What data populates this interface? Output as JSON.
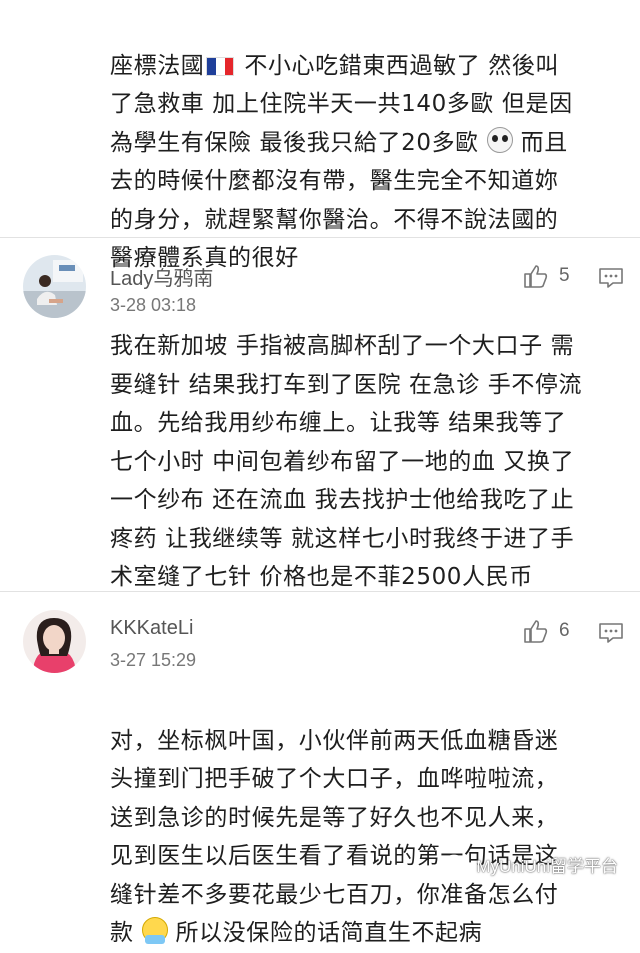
{
  "comments": [
    {
      "text_part1": "座標法國",
      "flag_colors": [
        "#1f3f9a",
        "#ffffff",
        "#e5262b"
      ],
      "text_part2": " 不小心吃錯東西過敏了 然後叫\n了急救車 加上住院半天一共140多歐 但是因\n為學生有保險 最後我只給了20多歐",
      "text_part3": "而且\n去的時候什麼都沒有帶，醫生完全不知道妳\n的身分，就趕緊幫你醫治。不得不說法國的\n醫療體系真的很好"
    },
    {
      "username": "Lady乌鸦南",
      "time": "3-28 03:18",
      "likes": "5",
      "text": "我在新加坡 手指被高脚杯刮了一个大口子 需\n要缝针 结果我打车到了医院 在急诊 手不停流\n血。先给我用纱布缠上。让我等 结果我等了\n七个小时 中间包着纱布留了一地的血 又换了\n一个纱布 还在流血 我去找护士他给我吃了止\n疼药 让我继续等 就这样七小时我终于进了手\n术室缝了七针  价格也是不菲2500人民币"
    },
    {
      "username": "KKKateLi",
      "time": "3-27 15:29",
      "likes": "6",
      "text_part1": "对，坐标枫叶国，小伙伴前两天低血糖昏迷\n头撞到门把手破了个大口子，血哗啦啦流，\n送到急诊的时候先是等了好久也不见人来，\n见到医生以后医生看了看说的第一句话是这\n缝针差不多要花最少七百刀，你准备怎么付\n款",
      "text_part2": " 所以没保险的话简直生不起病"
    }
  ],
  "watermark": "MyUniUni留学平台",
  "icons": {
    "like": "thumbs-up-icon",
    "reply": "comment-icon"
  }
}
